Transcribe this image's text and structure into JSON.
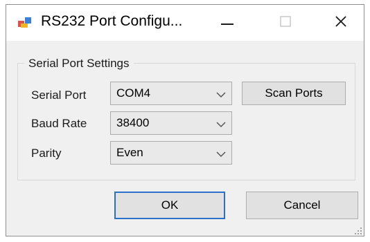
{
  "window": {
    "title": "RS232 Port Configu...",
    "icons": {
      "app": "serial-app-icon",
      "minimize": "minimize-icon",
      "maximize": "maximize-icon",
      "close": "close-icon",
      "grip": "resize-grip-icon"
    }
  },
  "group": {
    "legend": "Serial Port Settings"
  },
  "fields": {
    "serial_port": {
      "label": "Serial Port",
      "value": "COM4"
    },
    "baud_rate": {
      "label": "Baud Rate",
      "value": "38400"
    },
    "parity": {
      "label": "Parity",
      "value": "Even"
    }
  },
  "buttons": {
    "scan": "Scan Ports",
    "ok": "OK",
    "cancel": "Cancel"
  },
  "colors": {
    "accent": "#2a6fc9",
    "window_bg": "#f0f0f0",
    "titlebar_bg": "#ffffff"
  }
}
